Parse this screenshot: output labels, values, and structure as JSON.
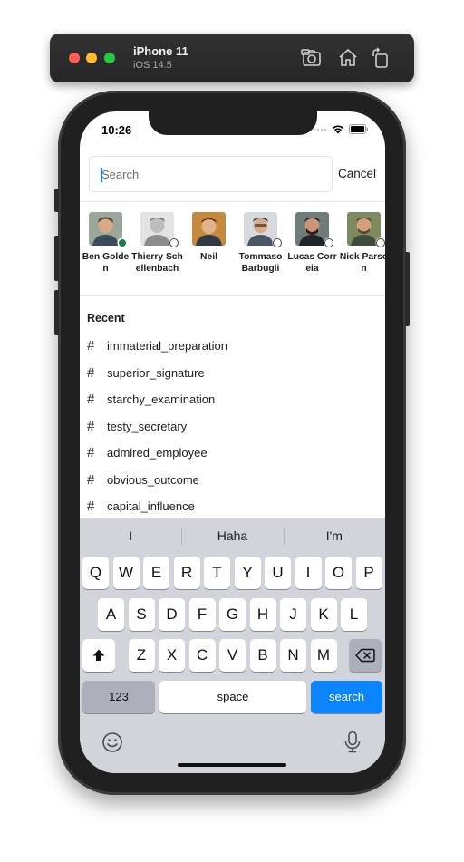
{
  "simulator": {
    "device": "iPhone 11",
    "os": "iOS 14.5",
    "icons": [
      "screenshot-icon",
      "home-icon",
      "rotate-icon"
    ]
  },
  "status_bar": {
    "time": "10:26"
  },
  "search": {
    "placeholder": "Search",
    "value": "",
    "cancel_label": "Cancel"
  },
  "people": [
    {
      "name": "Ben Golden",
      "status": "online"
    },
    {
      "name": "Thierry Schellenbach",
      "status": "away"
    },
    {
      "name": "Neil",
      "status": "none"
    },
    {
      "name": "Tommaso Barbugli",
      "status": "away"
    },
    {
      "name": "Lucas Correia",
      "status": "away"
    },
    {
      "name": "Nick Parson",
      "status": "away"
    }
  ],
  "recent": {
    "title": "Recent",
    "prefix": "#",
    "channels": [
      "immaterial_preparation",
      "superior_signature",
      "starchy_examination",
      "testy_secretary",
      "admired_employee",
      "obvious_outcome",
      "capital_influence"
    ]
  },
  "keyboard": {
    "suggestions": [
      "I",
      "Haha",
      "I'm"
    ],
    "rows": [
      [
        "Q",
        "W",
        "E",
        "R",
        "T",
        "Y",
        "U",
        "I",
        "O",
        "P"
      ],
      [
        "A",
        "S",
        "D",
        "F",
        "G",
        "H",
        "J",
        "K",
        "L"
      ],
      [
        "Z",
        "X",
        "C",
        "V",
        "B",
        "N",
        "M"
      ]
    ],
    "numbers_label": "123",
    "space_label": "space",
    "search_label": "search"
  },
  "colors": {
    "online": "#1f7b55",
    "keyboard_bg": "#d2d4db",
    "search_key": "#0a84ff",
    "sim_bar": "#2b2b2b"
  }
}
